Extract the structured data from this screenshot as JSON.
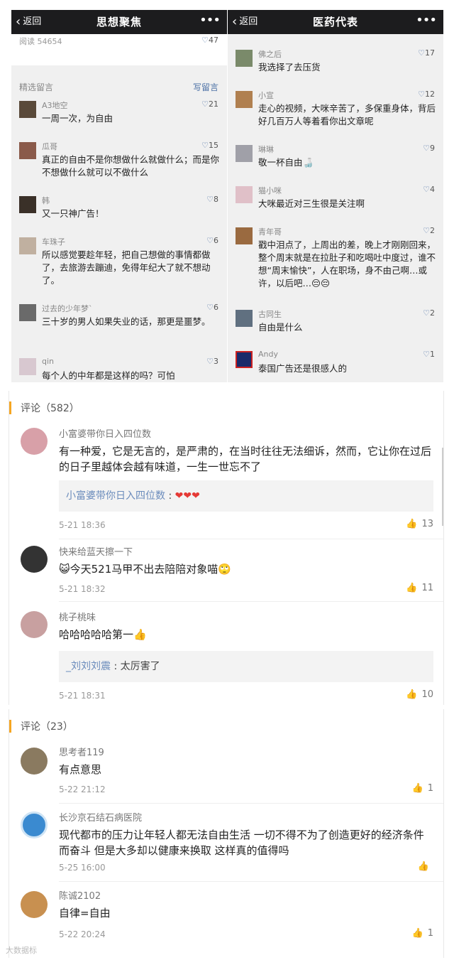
{
  "left_panel": {
    "back_label": "返回",
    "title": "思想聚焦",
    "more_label": "•••",
    "read_count": "阅读 54654",
    "like_count": "47",
    "selected_label": "精选留言",
    "write_label": "写留言",
    "comments": [
      {
        "name": "A3地空",
        "likes": "21",
        "text": "一周一次，为自由"
      },
      {
        "name": "瓜哥",
        "likes": "15",
        "text": "真正的自由不是你想做什么就做什么；而是你不想做什么就可以不做什么"
      },
      {
        "name": "韩",
        "likes": "8",
        "text": "又一只神广告！"
      },
      {
        "name": "车珠子",
        "likes": "6",
        "text": "所以感觉要趁年轻，把自己想做的事情都做了，去旅游去蹦迪，免得年纪大了就不想动了。"
      },
      {
        "name": "过去的少年梦`",
        "likes": "6",
        "text": "三十岁的男人如果失业的话，那更是噩梦。"
      },
      {
        "name": "qin",
        "likes": "3",
        "text": "每个人的中年都是这样的吗？可怕"
      }
    ]
  },
  "right_panel": {
    "back_label": "返回",
    "title": "医药代表",
    "more_label": "•••",
    "comments": [
      {
        "name": "佛之后",
        "likes": "17",
        "text": "我选择了去压货"
      },
      {
        "name": "小宣",
        "likes": "12",
        "text": "走心的视频，大咪辛苦了，多保重身体，背后好几百万人等着看你出文章呢"
      },
      {
        "name": "琳琳",
        "likes": "9",
        "text": "敬一杯自由🍶"
      },
      {
        "name": "猫小咪",
        "likes": "4",
        "text": "大咪最近对三生很是关注啊"
      },
      {
        "name": "青年哥",
        "likes": "2",
        "text": "戳中泪点了，上周出的差，晚上才刚刚回来，整个周末就是在拉肚子和吃喝吐中度过，谁不想“周末愉快”，人在职场，身不由己啊…或许，以后吧…😔😔"
      },
      {
        "name": "古同生",
        "likes": "2",
        "text": "自由是什么"
      },
      {
        "name": "Andy",
        "likes": "1",
        "text": "泰国广告还是很感人的"
      }
    ]
  },
  "card1": {
    "title": "评论（582）",
    "comments": [
      {
        "name": "小富婆带你日入四位数",
        "text": "有一种爱，它是无言的，是严肃的，在当时往往无法细诉，然而，它让你在过后的日子里越体会越有味道，一生一世忘不了",
        "reply_name": "小富婆带你日入四位数",
        "reply_text": "❤❤❤",
        "time": "5-21 18:36",
        "likes": "13"
      },
      {
        "name": "快来给蓝天擦一下",
        "text": "😺今天521马甲不出去陪陪对象喵🙄",
        "time": "5-21 18:32",
        "likes": "11"
      },
      {
        "name": "桃子桃味",
        "text": "哈哈哈哈哈第一👍",
        "reply_name": "_刘刘刘震",
        "reply_text": "太厉害了",
        "time": "5-21 18:31",
        "likes": "10"
      }
    ]
  },
  "card2": {
    "title": "评论（23）",
    "comments": [
      {
        "name": "思考者119",
        "text": "有点意思",
        "time": "5-22 21:12",
        "likes": "1"
      },
      {
        "name": "长沙京石结石病医院",
        "text": "现代都市的压力让年轻人都无法自由生活 一切不得不为了创造更好的经济条件而奋斗 但是大多却以健康来换取 这样真的值得吗",
        "time": "5-25 16:00",
        "likes": ""
      },
      {
        "name": "陈诚2102",
        "text": "自律=自由",
        "time": "5-22 20:24",
        "likes": "1"
      }
    ]
  },
  "watermark": "大数据标",
  "icons": {
    "heart": "heart-outline-icon",
    "thumb": "thumb-up-icon",
    "back": "chevron-left-icon"
  },
  "colors": {
    "navbar": "#1c1c1e",
    "accent_bar": "#f5a623",
    "reply_name": "#6b8cbc",
    "panel_bg": "#f0f0f0"
  }
}
